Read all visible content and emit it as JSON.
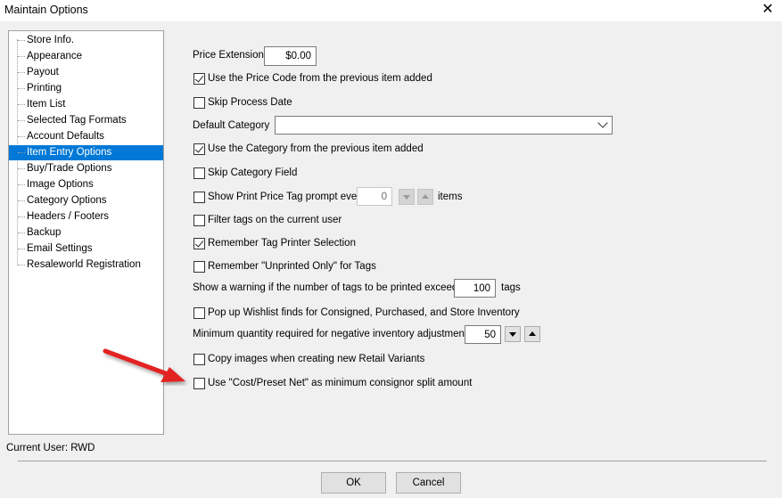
{
  "window": {
    "title": "Maintain Options",
    "close_glyph": "✕"
  },
  "tree": {
    "items": [
      {
        "label": "Store Info.",
        "selected": false
      },
      {
        "label": "Appearance",
        "selected": false
      },
      {
        "label": "Payout",
        "selected": false
      },
      {
        "label": "Printing",
        "selected": false
      },
      {
        "label": "Item List",
        "selected": false
      },
      {
        "label": "Selected Tag Formats",
        "selected": false
      },
      {
        "label": "Account Defaults",
        "selected": false
      },
      {
        "label": "Item Entry Options",
        "selected": true
      },
      {
        "label": "Buy/Trade Options",
        "selected": false
      },
      {
        "label": "Image Options",
        "selected": false
      },
      {
        "label": "Category Options",
        "selected": false
      },
      {
        "label": "Headers / Footers",
        "selected": false
      },
      {
        "label": "Backup",
        "selected": false
      },
      {
        "label": "Email Settings",
        "selected": false
      },
      {
        "label": "Resaleworld Registration",
        "selected": false
      }
    ]
  },
  "options": {
    "price_extension": {
      "label": "Price Extension",
      "value": "$0.00"
    },
    "use_price_code": {
      "label": "Use the Price Code from the previous item added",
      "checked": true
    },
    "skip_process_date": {
      "label": "Skip Process Date",
      "checked": false
    },
    "default_category": {
      "label": "Default Category",
      "value": ""
    },
    "use_category": {
      "label": "Use the Category from the previous item added",
      "checked": true
    },
    "skip_category_field": {
      "label": "Skip Category Field",
      "checked": false
    },
    "show_print_price_tag": {
      "label": "Show Print Price Tag prompt every",
      "checked": false,
      "value": "0",
      "suffix": "items"
    },
    "filter_tags": {
      "label": "Filter tags on the current user",
      "checked": false
    },
    "remember_tag_printer": {
      "label": "Remember Tag Printer Selection",
      "checked": true
    },
    "remember_unprinted": {
      "label": "Remember \"Unprinted Only\" for Tags",
      "checked": false
    },
    "tag_warning": {
      "label": "Show a warning if the number of tags to be printed exceeds",
      "value": "100",
      "suffix": "tags"
    },
    "popup_wishlist": {
      "label": "Pop up Wishlist finds for Consigned, Purchased, and Store Inventory",
      "checked": false
    },
    "min_quantity": {
      "label": "Minimum quantity required for negative inventory adjustments",
      "value": "50"
    },
    "copy_images": {
      "label": "Copy images when creating new Retail Variants",
      "checked": false
    },
    "use_cost_preset": {
      "label": "Use \"Cost/Preset Net\" as minimum consignor split amount",
      "checked": false
    }
  },
  "status": {
    "current_user": "Current User: RWD"
  },
  "buttons": {
    "ok": "OK",
    "cancel": "Cancel"
  },
  "colors": {
    "selection": "#0078d7",
    "arrow": "#e32222",
    "background": "#f0f0f0"
  }
}
